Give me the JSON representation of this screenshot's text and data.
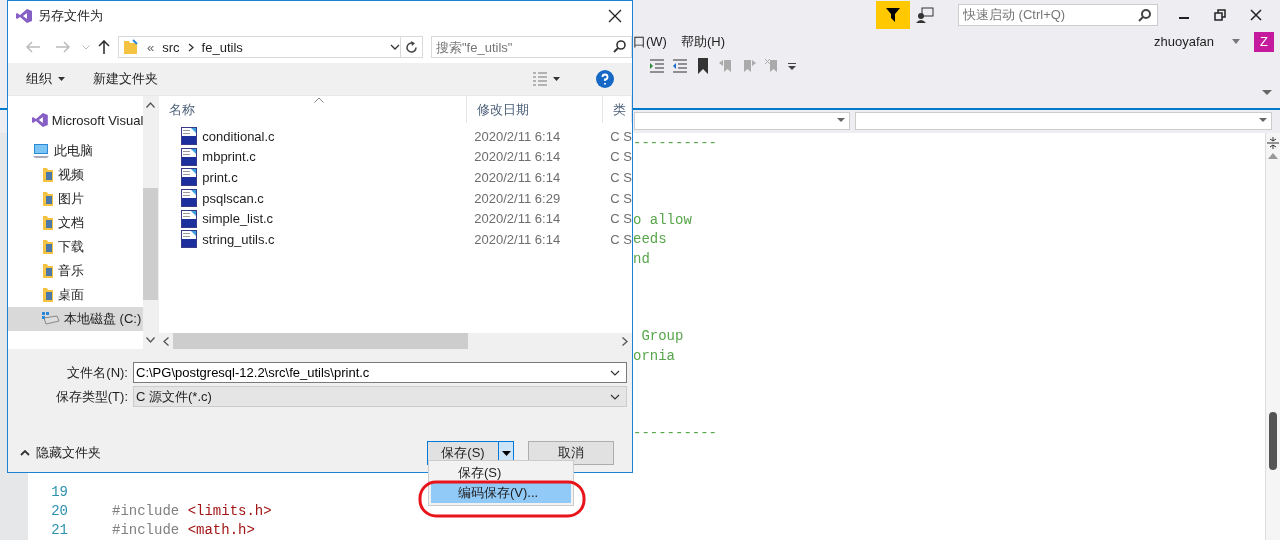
{
  "ide": {
    "quick_launch": {
      "placeholder": "快速启动 (Ctrl+Q)"
    },
    "menu": [
      "口(W)",
      "帮助(H)"
    ],
    "user": "zhuoyafan",
    "avatar": "Z",
    "editor_lines": [
      {
        "kind": "fragment",
        "text": "----------"
      },
      {
        "kind": "blank"
      },
      {
        "kind": "blank"
      },
      {
        "kind": "blank"
      },
      {
        "kind": "fragment",
        "text": "o allow"
      },
      {
        "kind": "fragment",
        "text": "eeds"
      },
      {
        "kind": "fragment",
        "text": "nd"
      },
      {
        "kind": "blank"
      },
      {
        "kind": "blank"
      },
      {
        "kind": "blank"
      },
      {
        "kind": "fragment",
        "text": " Group"
      },
      {
        "kind": "fragment",
        "text": "ornia"
      },
      {
        "kind": "blank"
      },
      {
        "kind": "blank"
      },
      {
        "kind": "blank"
      },
      {
        "kind": "fragment",
        "text": "----------"
      },
      {
        "kind": "blank"
      },
      {
        "kind": "blank"
      },
      {
        "kind": "code",
        "number": "19"
      },
      {
        "kind": "code",
        "number": "20",
        "directive": "#include",
        "header": "<limits.h>"
      },
      {
        "kind": "code",
        "number": "21",
        "directive": "#include",
        "header": "<math.h>"
      }
    ]
  },
  "dialog": {
    "title": "另存文件为",
    "address": {
      "overflow": "«",
      "path": [
        "src",
        "fe_utils"
      ]
    },
    "search": {
      "placeholder": "搜索\"fe_utils\""
    },
    "toolbar": {
      "organize": "组织",
      "new_folder": "新建文件夹"
    },
    "nav": [
      {
        "label": "Microsoft Visual",
        "kind": "app",
        "selected": false
      },
      {
        "label": "此电脑",
        "kind": "computer",
        "selected": false,
        "children": [
          {
            "label": "视频",
            "kind": "folder",
            "selected": false
          },
          {
            "label": "图片",
            "kind": "folder",
            "selected": false
          },
          {
            "label": "文档",
            "kind": "folder",
            "selected": false
          },
          {
            "label": "下载",
            "kind": "folder",
            "selected": false
          },
          {
            "label": "音乐",
            "kind": "folder",
            "selected": false
          },
          {
            "label": "桌面",
            "kind": "folder",
            "selected": false
          },
          {
            "label": "本地磁盘 (C:)",
            "kind": "drive",
            "selected": true
          }
        ]
      }
    ],
    "columns": [
      "名称",
      "修改日期",
      "类"
    ],
    "files": [
      {
        "name": "conditional.c",
        "modified": "2020/2/11 6:14",
        "type": "C S"
      },
      {
        "name": "mbprint.c",
        "modified": "2020/2/11 6:14",
        "type": "C S"
      },
      {
        "name": "print.c",
        "modified": "2020/2/11 6:14",
        "type": "C S"
      },
      {
        "name": "psqlscan.c",
        "modified": "2020/2/11 6:29",
        "type": "C S"
      },
      {
        "name": "simple_list.c",
        "modified": "2020/2/11 6:14",
        "type": "C S"
      },
      {
        "name": "string_utils.c",
        "modified": "2020/2/11 6:14",
        "type": "C S"
      }
    ],
    "file_name": {
      "label": "文件名(N):",
      "value": "C:\\PG\\postgresql-12.2\\src\\fe_utils\\print.c"
    },
    "file_type": {
      "label": "保存类型(T):",
      "value": "C 源文件(*.c)"
    },
    "hide_folders": "隐藏文件夹",
    "buttons": {
      "save": "保存(S)",
      "save_menu_open": true,
      "cancel": "取消"
    },
    "save_menu": [
      {
        "label": "保存(S)",
        "selected": false
      },
      {
        "label": "编码保存(V)...",
        "selected": true
      }
    ]
  }
}
